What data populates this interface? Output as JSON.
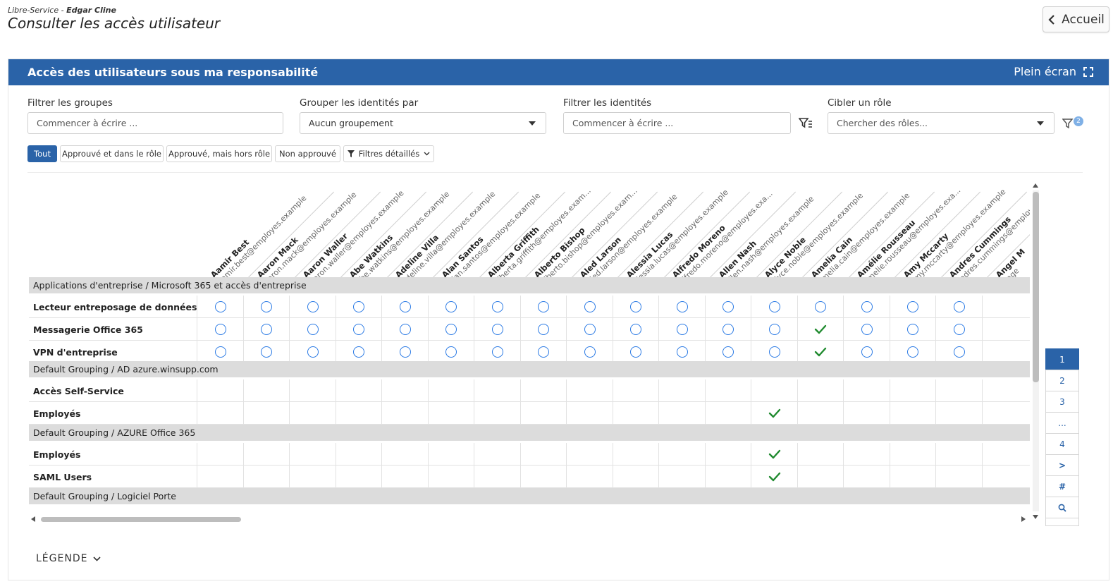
{
  "header": {
    "app": "Libre-Service",
    "separator": " - ",
    "user": "Edgar Cline",
    "title": "Consulter les accès utilisateur",
    "home_label": "Accueil"
  },
  "panel": {
    "title": "Accès des utilisateurs sous ma responsabilité",
    "fullscreen_label": "Plein écran"
  },
  "filters": {
    "groups": {
      "label": "Filtrer les groupes",
      "placeholder": "Commencer à écrire ..."
    },
    "grouping": {
      "label": "Grouper les identités par",
      "value": "Aucun groupement"
    },
    "identities": {
      "label": "Filtrer les identités",
      "placeholder": "Commencer à écrire ..."
    },
    "role": {
      "label": "Cibler un rôle",
      "placeholder": "Chercher des rôles..."
    },
    "badge_count": "2"
  },
  "pills": [
    "Tout",
    "Approuvé et dans le rôle",
    "Approuvé, mais hors rôle",
    "Non approuvé",
    "Filtres détaillés"
  ],
  "columns": [
    {
      "name": "Aamir Best",
      "email": "aamir.best@employes.example"
    },
    {
      "name": "Aaron Mack",
      "email": "aaron.mack@employes.example"
    },
    {
      "name": "Aaron Waller",
      "email": "aaron.waller@employes.example"
    },
    {
      "name": "Abe Watkins",
      "email": "abe.watkins@employes.example"
    },
    {
      "name": "Adeline Villa",
      "email": "adeline.villa@employes.example"
    },
    {
      "name": "Alan Santos",
      "email": "alan.santos@employes.example"
    },
    {
      "name": "Alberta Griffith",
      "email": "alberta.griffith@employes.exam..."
    },
    {
      "name": "Alberto Bishop",
      "email": "alberto.bishop@employes.exam..."
    },
    {
      "name": "Aled Larson",
      "email": "aled.larson@employes.example"
    },
    {
      "name": "Alessia Lucas",
      "email": "alessia.lucas@employes.example"
    },
    {
      "name": "Alfredo Moreno",
      "email": "alfredo.moreno@employes.exa..."
    },
    {
      "name": "Allen Nash",
      "email": "allen.nash@employes.example"
    },
    {
      "name": "Alyce Noble",
      "email": "alyce.noble@employes.example"
    },
    {
      "name": "Amelia Cain",
      "email": "amelia.cain@employes.example"
    },
    {
      "name": "Amélie Rousseau",
      "email": "amelie.rousseau@employes.exa..."
    },
    {
      "name": "Amy Mccarty",
      "email": "amy.mccarty@employes.example"
    },
    {
      "name": "Andres Cummings",
      "email": "andres.cummings@employes.ex"
    },
    {
      "name": "Angel M",
      "email": "ange"
    }
  ],
  "groups": [
    {
      "title": "Applications d'entreprise / Microsoft 365 et accès d'entreprise",
      "rows": [
        {
          "label": "Lecteur entreposage de données",
          "cells": [
            "o",
            "o",
            "o",
            "o",
            "o",
            "o",
            "o",
            "o",
            "o",
            "o",
            "o",
            "o",
            "o",
            "o",
            "o",
            "o",
            "o",
            ""
          ]
        },
        {
          "label": "Messagerie Office 365",
          "cells": [
            "o",
            "o",
            "o",
            "o",
            "o",
            "o",
            "o",
            "o",
            "o",
            "o",
            "o",
            "o",
            "o",
            "v",
            "o",
            "o",
            "o",
            ""
          ]
        },
        {
          "label": "VPN d'entreprise",
          "cells": [
            "o",
            "o",
            "o",
            "o",
            "o",
            "o",
            "o",
            "o",
            "o",
            "o",
            "o",
            "o",
            "o",
            "v",
            "o",
            "o",
            "o",
            ""
          ]
        }
      ]
    },
    {
      "title": "Default Grouping / AD azure.winsupp.com",
      "rows": [
        {
          "label": "Accès Self-Service",
          "cells": [
            "",
            "",
            "",
            "",
            "",
            "",
            "",
            "",
            "",
            "",
            "",
            "",
            "",
            "",
            "",
            "",
            "",
            ""
          ]
        },
        {
          "label": "Employés",
          "cells": [
            "",
            "",
            "",
            "",
            "",
            "",
            "",
            "",
            "",
            "",
            "",
            "",
            "v",
            "",
            "",
            "",
            "",
            ""
          ]
        }
      ]
    },
    {
      "title": "Default Grouping / AZURE Office 365",
      "rows": [
        {
          "label": "Employés",
          "cells": [
            "",
            "",
            "",
            "",
            "",
            "",
            "",
            "",
            "",
            "",
            "",
            "",
            "v",
            "",
            "",
            "",
            "",
            ""
          ]
        },
        {
          "label": "SAML Users",
          "cells": [
            "",
            "",
            "",
            "",
            "",
            "",
            "",
            "",
            "",
            "",
            "",
            "",
            "v",
            "",
            "",
            "",
            "",
            ""
          ]
        }
      ]
    },
    {
      "title": "Default Grouping / Logiciel Porte",
      "rows": []
    }
  ],
  "pager": [
    "1",
    "2",
    "3",
    "...",
    "4",
    ">",
    "#"
  ],
  "pager_active": "1",
  "legend_label": "LÉGENDE",
  "colors": {
    "primary": "#2a63a8",
    "circle": "#2c7be5",
    "check": "#1f8a2e",
    "group_bg": "#dcdcdc"
  },
  "icons": [
    "chevron-left-icon",
    "fullscreen-icon",
    "filter-list-icon",
    "filter-icon",
    "chevron-down-icon",
    "search-icon"
  ]
}
